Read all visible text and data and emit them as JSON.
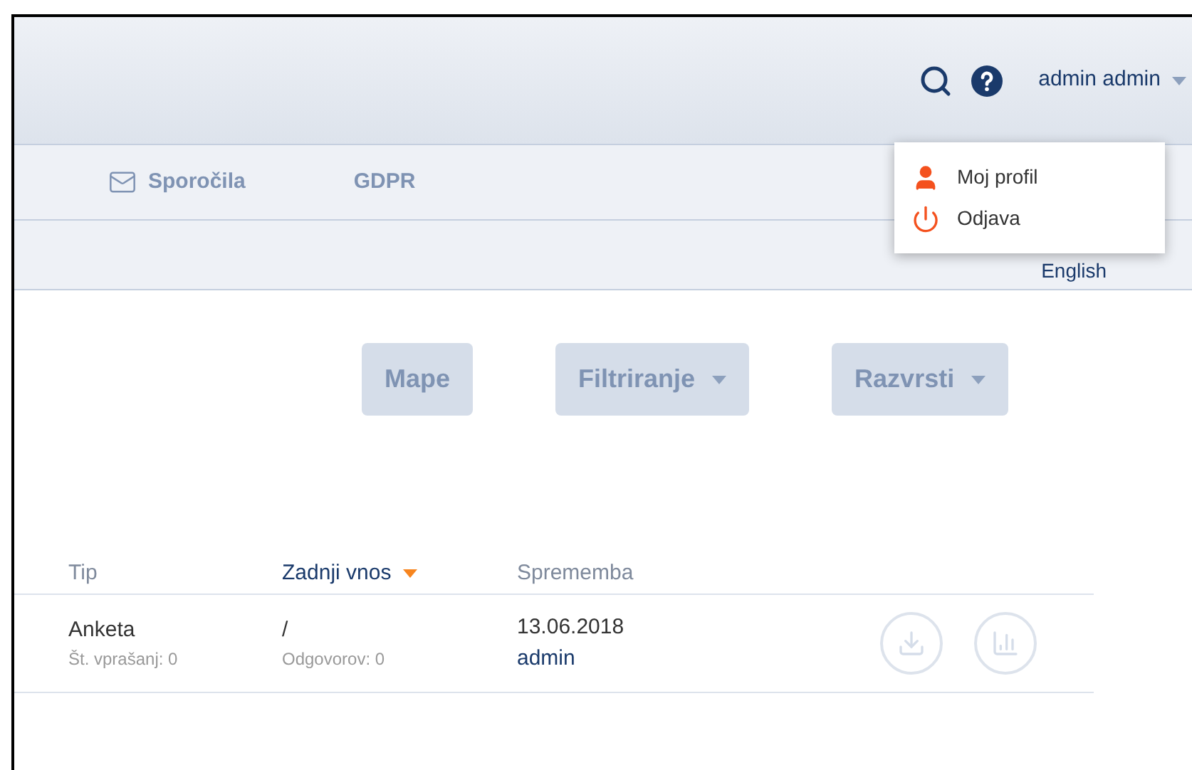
{
  "header": {
    "user": "admin admin"
  },
  "nav": [
    {
      "label": "Sporočila"
    },
    {
      "label": "GDPR"
    }
  ],
  "language": "English",
  "user_menu": [
    {
      "label": "Moj profil"
    },
    {
      "label": "Odjava"
    }
  ],
  "toolbar": [
    {
      "label": "Mape",
      "dropdown": false
    },
    {
      "label": "Filtriranje",
      "dropdown": true
    },
    {
      "label": "Razvrsti",
      "dropdown": true
    }
  ],
  "table": {
    "columns": [
      {
        "label": "Tip",
        "sorted": false
      },
      {
        "label": "Zadnji vnos",
        "sorted": true
      },
      {
        "label": "Sprememba",
        "sorted": false
      }
    ],
    "rows": [
      {
        "type": "Anketa",
        "type_sub": "Št. vprašanj: 0",
        "last": "/",
        "last_sub": "Odgovorov: 0",
        "date": "13.06.2018",
        "user": "admin"
      }
    ]
  }
}
